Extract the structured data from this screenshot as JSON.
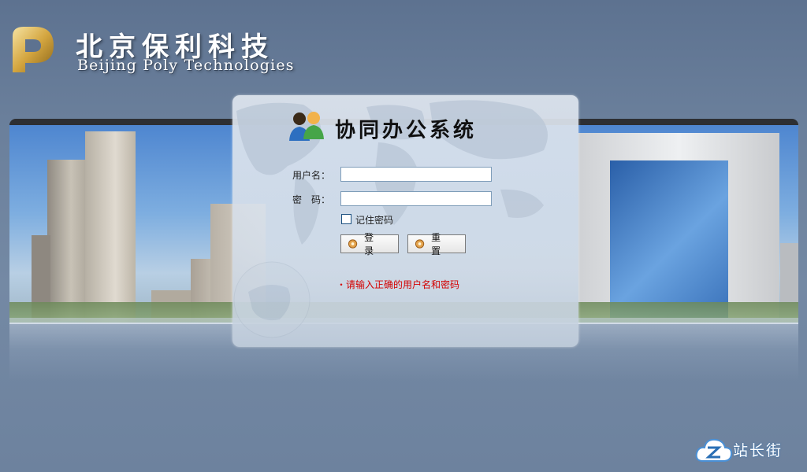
{
  "logo": {
    "cn": "北京保利科技",
    "en": "Beijing Poly Technologies",
    "mark_icon": "poly-p-logo-icon"
  },
  "login": {
    "title": "协同办公系统",
    "title_icon": "users-icon",
    "username_label": "用户名：",
    "username_value": "",
    "password_label": "密　码：",
    "password_value": "",
    "remember_label": "记住密码",
    "remember_checked": false,
    "login_button": "登 录",
    "reset_button": "重 置",
    "error_message": "・请输入正确的用户名和密码"
  },
  "watermark": {
    "text": "站长街",
    "icon": "cloud-z-icon"
  },
  "colors": {
    "background": "#6a7f9b",
    "error": "#d40000",
    "banner_border": "#2d2f33"
  }
}
